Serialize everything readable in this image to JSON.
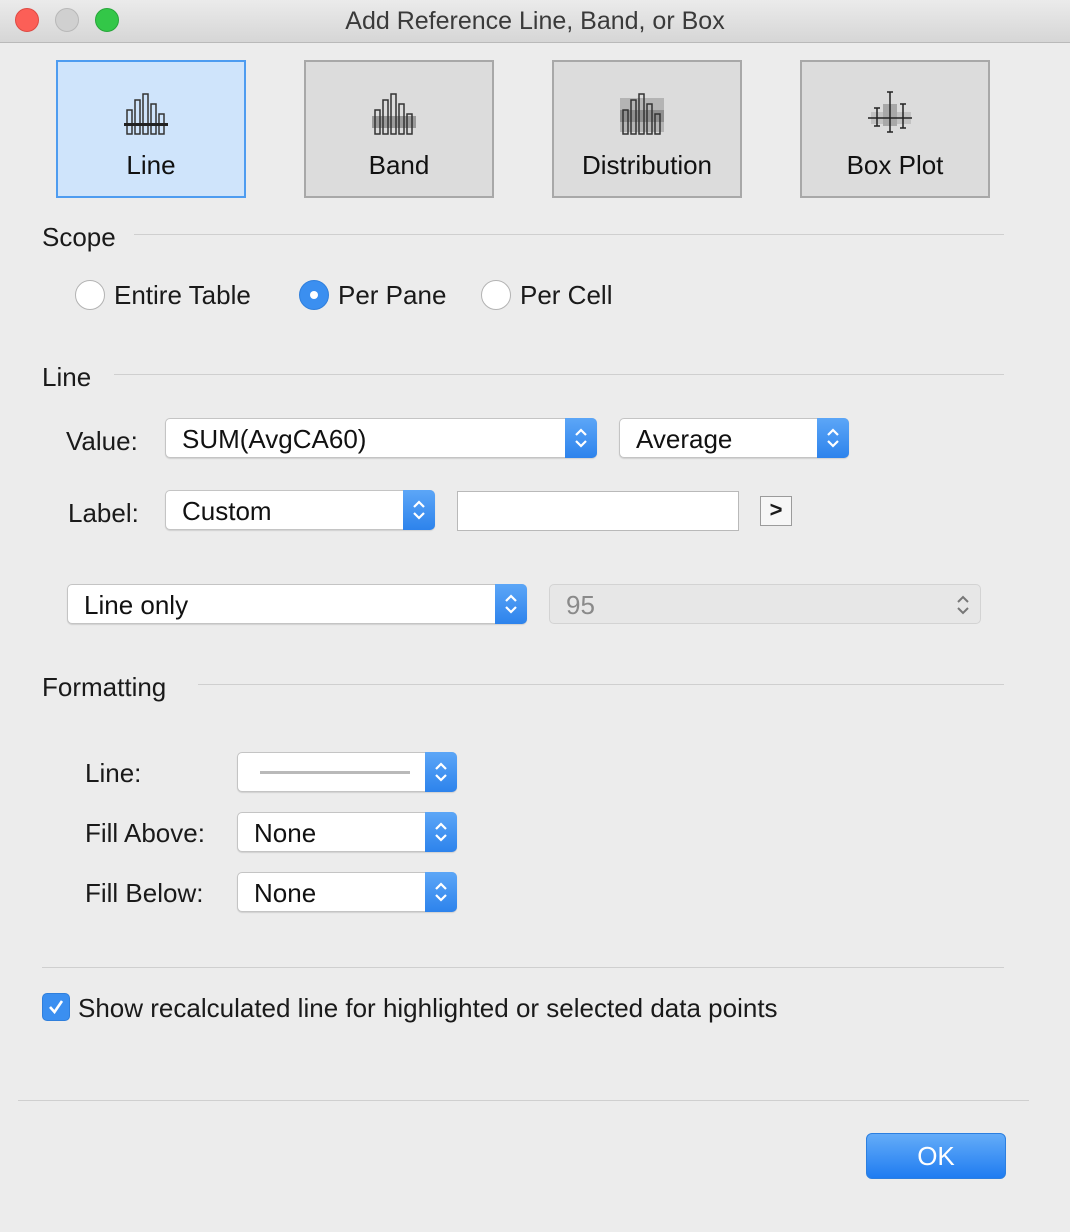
{
  "window": {
    "title": "Add Reference Line, Band, or Box"
  },
  "types": [
    {
      "label": "Line",
      "icon": "reference-line-icon",
      "selected": true
    },
    {
      "label": "Band",
      "icon": "reference-band-icon",
      "selected": false
    },
    {
      "label": "Distribution",
      "icon": "distribution-icon",
      "selected": false
    },
    {
      "label": "Box Plot",
      "icon": "box-plot-icon",
      "selected": false
    }
  ],
  "scope": {
    "title": "Scope",
    "options": [
      "Entire Table",
      "Per Pane",
      "Per Cell"
    ],
    "selected": "Per Pane"
  },
  "line": {
    "title": "Line",
    "value_label": "Value:",
    "value_field": "SUM(AvgCA60)",
    "aggregation": "Average",
    "label_label": "Label:",
    "label_mode": "Custom",
    "custom_label_text": "",
    "insert_button": ">",
    "display_mode": "Line only",
    "confidence": "95"
  },
  "formatting": {
    "title": "Formatting",
    "line_label": "Line:",
    "fill_above_label": "Fill Above:",
    "fill_above_value": "None",
    "fill_below_label": "Fill Below:",
    "fill_below_value": "None"
  },
  "recalc": {
    "label": "Show recalculated line for highlighted or selected data points",
    "checked": true
  },
  "footer": {
    "ok_label": "OK"
  },
  "colors": {
    "accent": "#3b8ff0",
    "selected_tile": "#cfe4fb",
    "close": "#fc5f57",
    "zoom": "#33c748"
  }
}
